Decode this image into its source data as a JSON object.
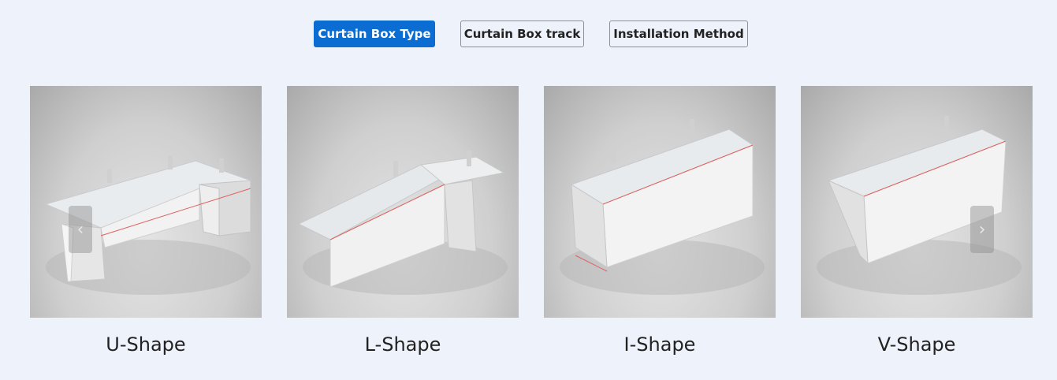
{
  "tabs": [
    {
      "label": "Curtain Box Type",
      "active": true
    },
    {
      "label": "Curtain Box track",
      "active": false
    },
    {
      "label": "Installation Method",
      "active": false
    }
  ],
  "cards": [
    {
      "label": "U-Shape",
      "icon": "u-shape-curtain-box-image"
    },
    {
      "label": "L-Shape",
      "icon": "l-shape-curtain-box-image"
    },
    {
      "label": "I-Shape",
      "icon": "i-shape-curtain-box-image"
    },
    {
      "label": "V-Shape",
      "icon": "v-shape-curtain-box-image"
    }
  ],
  "carousel": {
    "prev_glyph": "‹",
    "next_glyph": "›"
  },
  "colors": {
    "accent": "#0b6dd1",
    "page_background": "#eef2fa"
  }
}
